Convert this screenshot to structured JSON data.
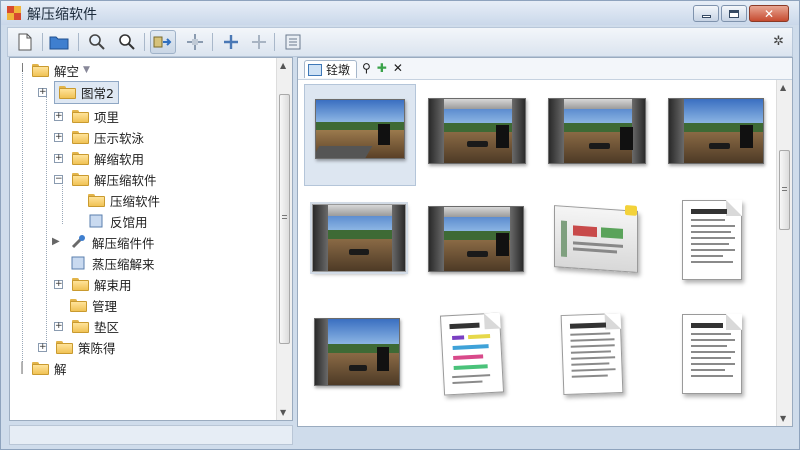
{
  "window": {
    "title": "解压缩软件",
    "buttons": {
      "minimize": "minimize",
      "maximize": "maximize",
      "close": "close"
    }
  },
  "toolbar": {
    "icons": [
      "new-icon",
      "open-folder-icon",
      "zoom-icon",
      "search-icon",
      "export-icon",
      "move-icon",
      "add-icon",
      "add-disabled-icon",
      "calculator-icon"
    ],
    "settings_icon": "gear-icon"
  },
  "tree": {
    "root": "解空",
    "selected": "图常2",
    "items": [
      {
        "label": "项里"
      },
      {
        "label": "压示软泳"
      },
      {
        "label": "解缩软用"
      },
      {
        "label": "解压缩软件"
      },
      {
        "label": "压缩软件"
      },
      {
        "label": "反馆用"
      },
      {
        "label": "解压缩件件"
      },
      {
        "label": "蒸压缩解来"
      },
      {
        "label": "解束用"
      },
      {
        "label": "管理"
      },
      {
        "label": "垫区"
      },
      {
        "label": "策陈得"
      },
      {
        "label": "解"
      }
    ]
  },
  "view": {
    "tab_label": "铨墩",
    "tools": [
      "search-icon",
      "add-icon",
      "close-icon"
    ],
    "thumbnails": [
      "photo-road",
      "photo-living-room",
      "photo-living-room",
      "photo-living-room-wide",
      "photo-living-room",
      "photo-living-room",
      "slide-presentation",
      "document-text",
      "photo-living-room",
      "document-colored",
      "document-text",
      "document-text"
    ]
  }
}
